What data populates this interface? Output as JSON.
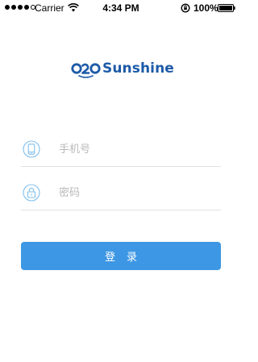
{
  "status_bar": {
    "carrier": "Carrier",
    "time": "4:34 PM",
    "battery": "100%",
    "icons": [
      "signal-dots-icon",
      "wifi-icon",
      "rotation-lock-icon",
      "battery-icon"
    ]
  },
  "logo": {
    "mark": "O2O",
    "text": "Sunshine",
    "color": "#1d5aa8"
  },
  "form": {
    "phone_placeholder": "手机号",
    "phone_value": "",
    "phone_icon": "phone-icon",
    "password_placeholder": "密码",
    "password_value": "",
    "password_icon": "lock-icon",
    "icon_color": "#7fbfee",
    "field_divider_color": "#e2e2e2"
  },
  "login_button": {
    "label": "登录",
    "color": "#3d97e4"
  }
}
